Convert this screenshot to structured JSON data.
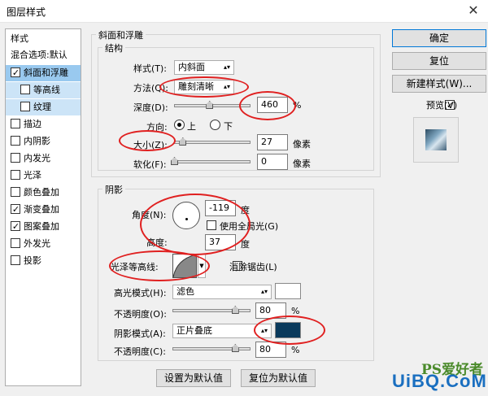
{
  "window": {
    "title": "图层样式",
    "close": "✕"
  },
  "styles_list": [
    {
      "label": "样式",
      "checkbox": false
    },
    {
      "label": "混合选项:默认",
      "checkbox": false
    },
    {
      "label": "斜面和浮雕",
      "checkbox": true,
      "checked": true,
      "selected": true
    },
    {
      "label": "等高线",
      "checkbox": true,
      "checked": false,
      "sub": true
    },
    {
      "label": "纹理",
      "checkbox": true,
      "checked": false,
      "sub": true
    },
    {
      "label": "描边",
      "checkbox": true,
      "checked": false
    },
    {
      "label": "内阴影",
      "checkbox": true,
      "checked": false
    },
    {
      "label": "内发光",
      "checkbox": true,
      "checked": false
    },
    {
      "label": "光泽",
      "checkbox": true,
      "checked": false
    },
    {
      "label": "颜色叠加",
      "checkbox": true,
      "checked": false
    },
    {
      "label": "渐变叠加",
      "checkbox": true,
      "checked": true
    },
    {
      "label": "图案叠加",
      "checkbox": true,
      "checked": true
    },
    {
      "label": "外发光",
      "checkbox": true,
      "checked": false
    },
    {
      "label": "投影",
      "checkbox": true,
      "checked": false
    }
  ],
  "bevel": {
    "group_title": "斜面和浮雕",
    "structure_title": "结构",
    "style_label": "样式(T):",
    "style_value": "内斜面",
    "technique_label": "方法(Q):",
    "technique_value": "雕刻清晰",
    "depth_label": "深度(D):",
    "depth_value": "460",
    "depth_unit": "%",
    "depth_slider": 0.46,
    "direction_label": "方向:",
    "dir_up": "上",
    "dir_down": "下",
    "size_label": "大小(Z):",
    "size_value": "27",
    "size_unit": "像素",
    "size_slider": 0.11,
    "soften_label": "软化(F):",
    "soften_value": "0",
    "soften_unit": "像素",
    "soften_slider": 0.0
  },
  "shading": {
    "title": "阴影",
    "angle_label": "角度(N):",
    "angle_value": "-119",
    "angle_unit": "度",
    "global_light_label": "使用全局光(G)",
    "altitude_label": "高度:",
    "altitude_value": "37",
    "altitude_unit": "度",
    "gloss_label": "光泽等高线:",
    "anti_alias_label": "消除锯齿(L)",
    "highlight_mode_label": "高光模式(H):",
    "highlight_mode_value": "滤色",
    "highlight_color": "#ffffff",
    "highlight_opacity_label": "不透明度(O):",
    "highlight_opacity_value": "80",
    "highlight_opacity_unit": "%",
    "highlight_opacity_slider": 0.8,
    "shadow_mode_label": "阴影模式(A):",
    "shadow_mode_value": "正片叠底",
    "shadow_color": "#0a3a5c",
    "shadow_opacity_label": "不透明度(C):",
    "shadow_opacity_value": "80",
    "shadow_opacity_unit": "%",
    "shadow_opacity_slider": 0.8
  },
  "bottom_buttons": {
    "make_default": "设置为默认值",
    "reset_default": "复位为默认值"
  },
  "right": {
    "ok": "确定",
    "reset": "复位",
    "new_style": "新建样式(W)...",
    "preview_label": "预览(V)"
  },
  "watermark": {
    "brand": "PS爱好者",
    "site": "UiBQ.CoM"
  },
  "colors": {
    "accent": "#e02020",
    "selection": "#99c9ef"
  }
}
